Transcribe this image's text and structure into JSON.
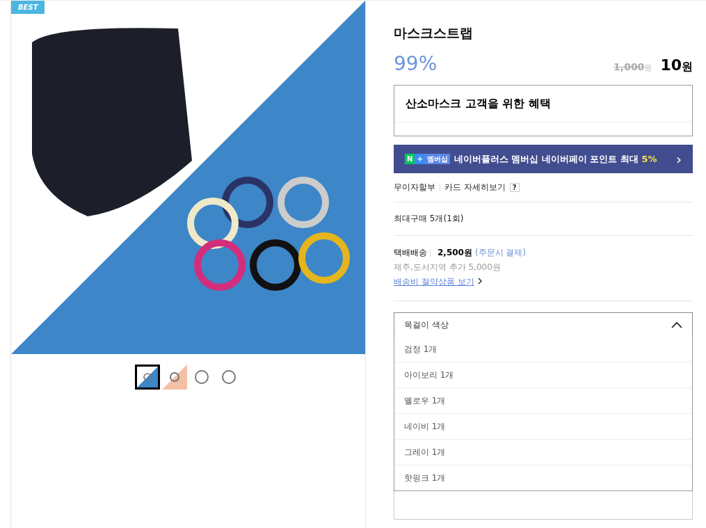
{
  "badge": "BEST",
  "thumbnails": [
    {
      "selected": true
    },
    {
      "selected": false
    },
    {
      "selected": false
    },
    {
      "selected": false
    }
  ],
  "product": {
    "title": "마스크스트랩",
    "discount": "99%",
    "original_price": "1,000",
    "original_unit": "원",
    "price": "10",
    "price_unit": "원"
  },
  "benefit": {
    "title": "산소마스크 고객을 위한 혜택"
  },
  "membership_banner": {
    "logo_n": "N",
    "logo_plus": "+",
    "logo_label": "멤버십",
    "text": "네이버플러스 멤버십 네이버페이 포인트 최대 **5%**",
    "arrow": "›"
  },
  "installment": {
    "label": "무이자할부",
    "link": "카드 자세히보기",
    "help": "?"
  },
  "max_purchase": "최대구매 5개(1회)",
  "shipping": {
    "label": "택배배송",
    "fee": "2,500원",
    "note": "(주문시 결제)",
    "extra": "제주,도서지역 추가 5,000원",
    "link": "배송비 절약상품 보기"
  },
  "option_select": {
    "label": "목걸이 색상",
    "expanded": true,
    "options": [
      "검정 1개",
      "아이보리 1개",
      "옐로우 1개",
      "네이비 1개",
      "그레이 1개",
      "핫핑크 1개"
    ]
  }
}
